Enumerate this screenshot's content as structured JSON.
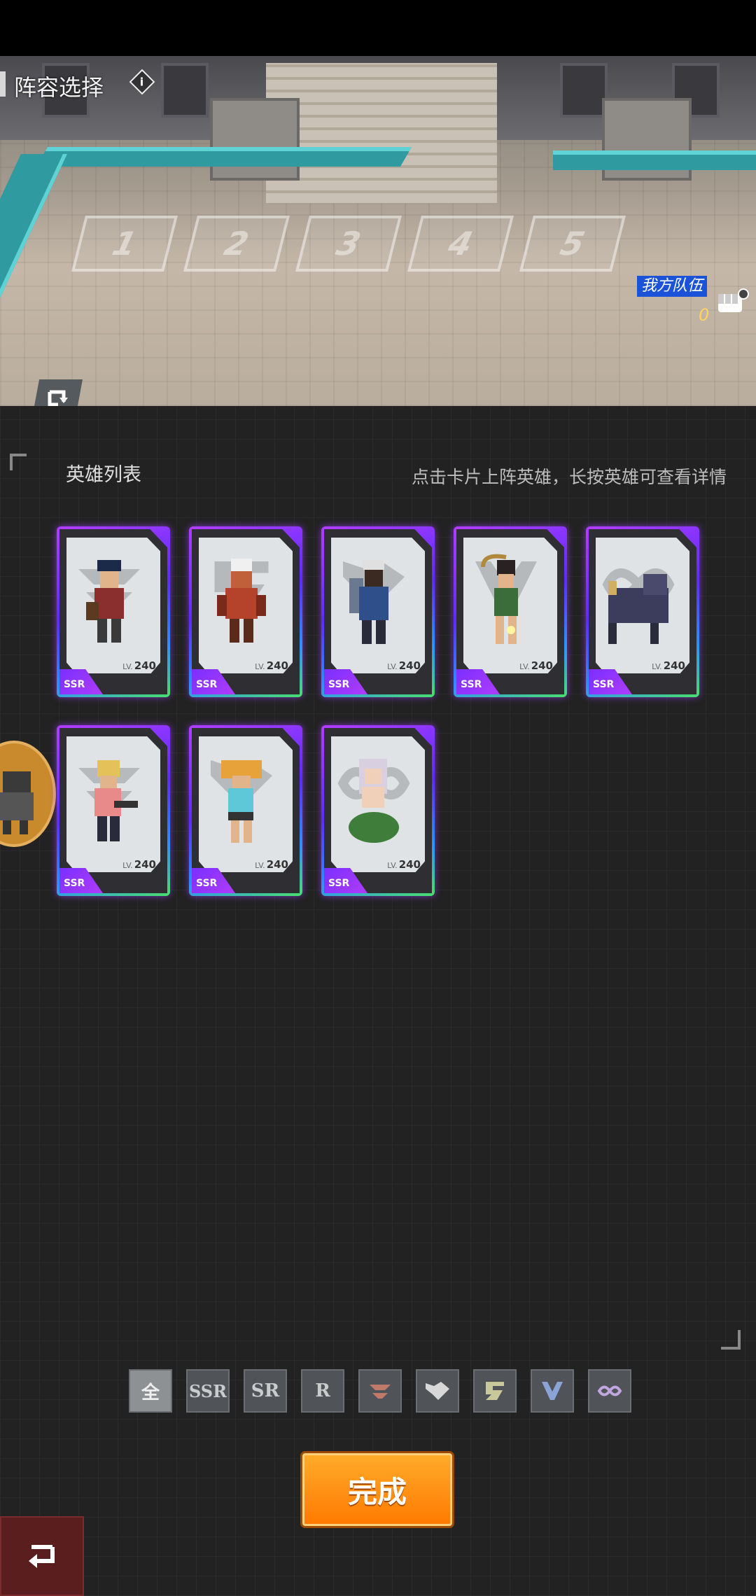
{
  "formation": {
    "title": "阵容选择",
    "info_glyph": "i",
    "slots": [
      "1",
      "2",
      "3",
      "4",
      "5"
    ],
    "team_label": "我方队伍",
    "team_count": "0"
  },
  "hero_list": {
    "title": "英雄列表",
    "hint": "点击卡片上阵英雄，长按英雄可查看详情",
    "heroes": [
      {
        "rarity": "SSR",
        "level": "240",
        "lv_label": "LV.",
        "emblem": "wing-emblem-icon",
        "accent": "#8b2e2e"
      },
      {
        "rarity": "SSR",
        "level": "240",
        "lv_label": "LV.",
        "emblem": "dragon-emblem-icon",
        "accent": "#b5432c"
      },
      {
        "rarity": "SSR",
        "level": "240",
        "lv_label": "LV.",
        "emblem": "wolf-emblem-icon",
        "accent": "#2f4f8b"
      },
      {
        "rarity": "SSR",
        "level": "240",
        "lv_label": "LV.",
        "emblem": "claw-emblem-icon",
        "accent": "#3a6d3a"
      },
      {
        "rarity": "SSR",
        "level": "240",
        "lv_label": "LV.",
        "emblem": "infinity-emblem-icon",
        "accent": "#3c3d5c"
      },
      {
        "rarity": "SSR",
        "level": "240",
        "lv_label": "LV.",
        "emblem": "wing-emblem-icon",
        "accent": "#e5c15a"
      },
      {
        "rarity": "SSR",
        "level": "240",
        "lv_label": "LV.",
        "emblem": "wolf-emblem-icon",
        "accent": "#e8a23a"
      },
      {
        "rarity": "SSR",
        "level": "240",
        "lv_label": "LV.",
        "emblem": "infinity-emblem-icon",
        "accent": "#3f7d3a"
      }
    ]
  },
  "filters": {
    "all": "全",
    "ssr": "SSR",
    "sr": "SR",
    "r": "R",
    "icons": [
      "wing-faction-icon",
      "wolf-faction-icon",
      "dragon-faction-icon",
      "claw-faction-icon",
      "infinity-faction-icon"
    ]
  },
  "actions": {
    "done": "完成"
  },
  "colors": {
    "card_glow_start": "#b23dff",
    "card_glow_end": "#48e06a",
    "done_button": "#ff8a00",
    "team_label_bg": "#1b53d8",
    "back_button_bg": "#5b1e1e"
  }
}
